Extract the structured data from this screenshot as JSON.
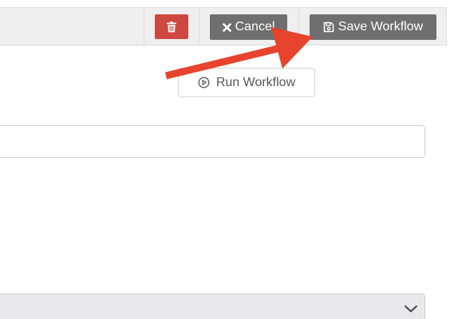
{
  "toolbar": {
    "delete_icon": "trash-icon",
    "cancel_label": "Cancel",
    "cancel_icon": "x-icon",
    "save_label": "Save Workflow",
    "save_icon": "floppy-disk-icon",
    "delete_color": "#cf4740",
    "button_color": "#6f6f6f"
  },
  "main": {
    "run_label": "Run Workflow",
    "run_icon": "play-circle-icon",
    "text_input_value": "",
    "select_value": "",
    "select_icon": "chevron-down-icon"
  },
  "annotation": {
    "arrow_color": "#e8432c",
    "arrow_target": "save-workflow-button"
  }
}
